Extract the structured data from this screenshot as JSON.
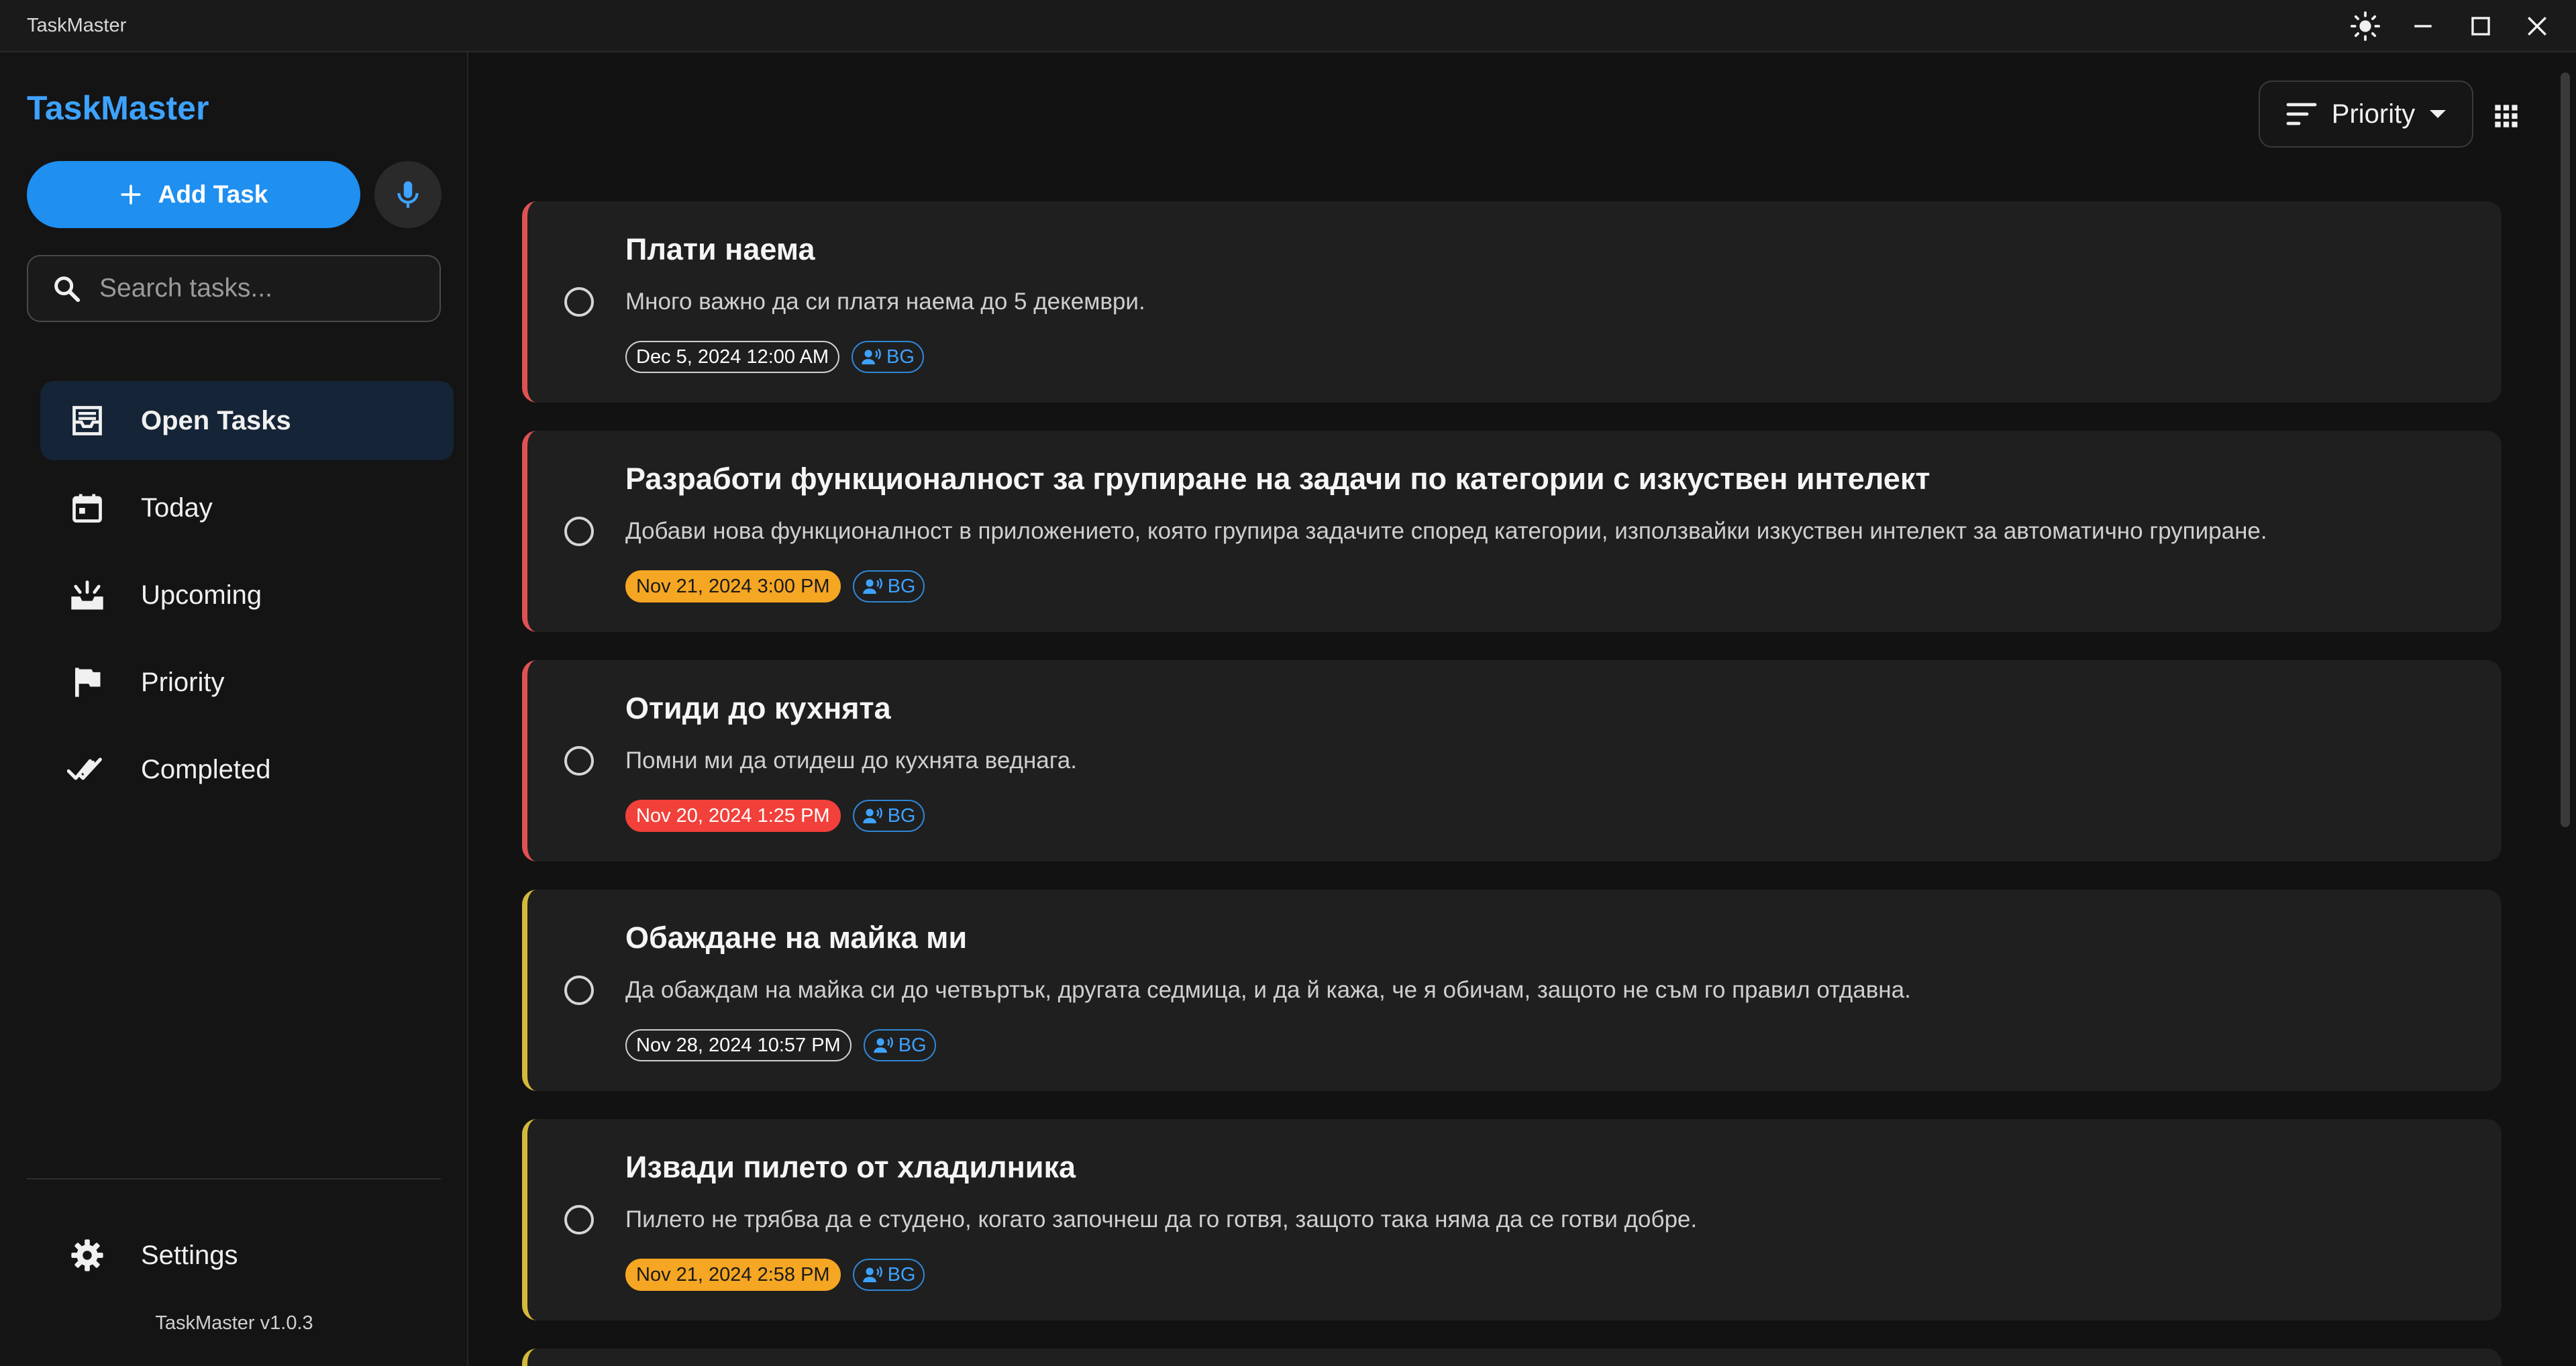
{
  "window": {
    "title": "TaskMaster"
  },
  "sidebar": {
    "brand": "TaskMaster",
    "add_task_label": "Add Task",
    "search_placeholder": "Search tasks...",
    "nav": [
      {
        "label": "Open Tasks",
        "icon": "inbox-icon",
        "active": true
      },
      {
        "label": "Today",
        "icon": "calendar-icon"
      },
      {
        "label": "Upcoming",
        "icon": "upcoming-icon"
      },
      {
        "label": "Priority",
        "icon": "flag-icon"
      },
      {
        "label": "Completed",
        "icon": "done-all-icon"
      }
    ],
    "settings_label": "Settings",
    "version": "TaskMaster v1.0.3"
  },
  "toolbar": {
    "sort_label": "Priority"
  },
  "colors": {
    "accent": "#1f8ff0",
    "brand": "#3ea2ff",
    "high_priority": "#e05252",
    "medium_priority": "#d4b93a",
    "due_soon": "#f5a623",
    "overdue": "#f2403a"
  },
  "tasks": [
    {
      "title": "Плати наема",
      "description": "Много важно да си платя наема до 5 декември.",
      "date": "Dec 5, 2024 12:00 AM",
      "date_status": "normal",
      "lang": "BG",
      "priority": "high"
    },
    {
      "title": "Разработи функционалност за групиране на задачи по категории с изкуствен интелект",
      "description": "Добави нова функционалност в приложението, която групира задачите според категории, използвайки изкуствен интелект за автоматично групиране.",
      "date": "Nov 21, 2024 3:00 PM",
      "date_status": "due_soon",
      "lang": "BG",
      "priority": "high"
    },
    {
      "title": "Отиди до кухнята",
      "description": "Помни ми да отидеш до кухнята веднага.",
      "date": "Nov 20, 2024 1:25 PM",
      "date_status": "overdue",
      "lang": "BG",
      "priority": "high"
    },
    {
      "title": "Обаждане на майка ми",
      "description": "Да обаждам на майка си до четвъртък, другата седмица, и да й кажа, че я обичам, защото не съм го правил отдавна.",
      "date": "Nov 28, 2024 10:57 PM",
      "date_status": "normal",
      "lang": "BG",
      "priority": "medium"
    },
    {
      "title": "Извади пилето от хладилника",
      "description": "Пилето не трябва да е студено, когато започнеш да го готвя, защото така няма да се готви добре.",
      "date": "Nov 21, 2024 2:58 PM",
      "date_status": "due_soon",
      "lang": "BG",
      "priority": "medium"
    }
  ]
}
